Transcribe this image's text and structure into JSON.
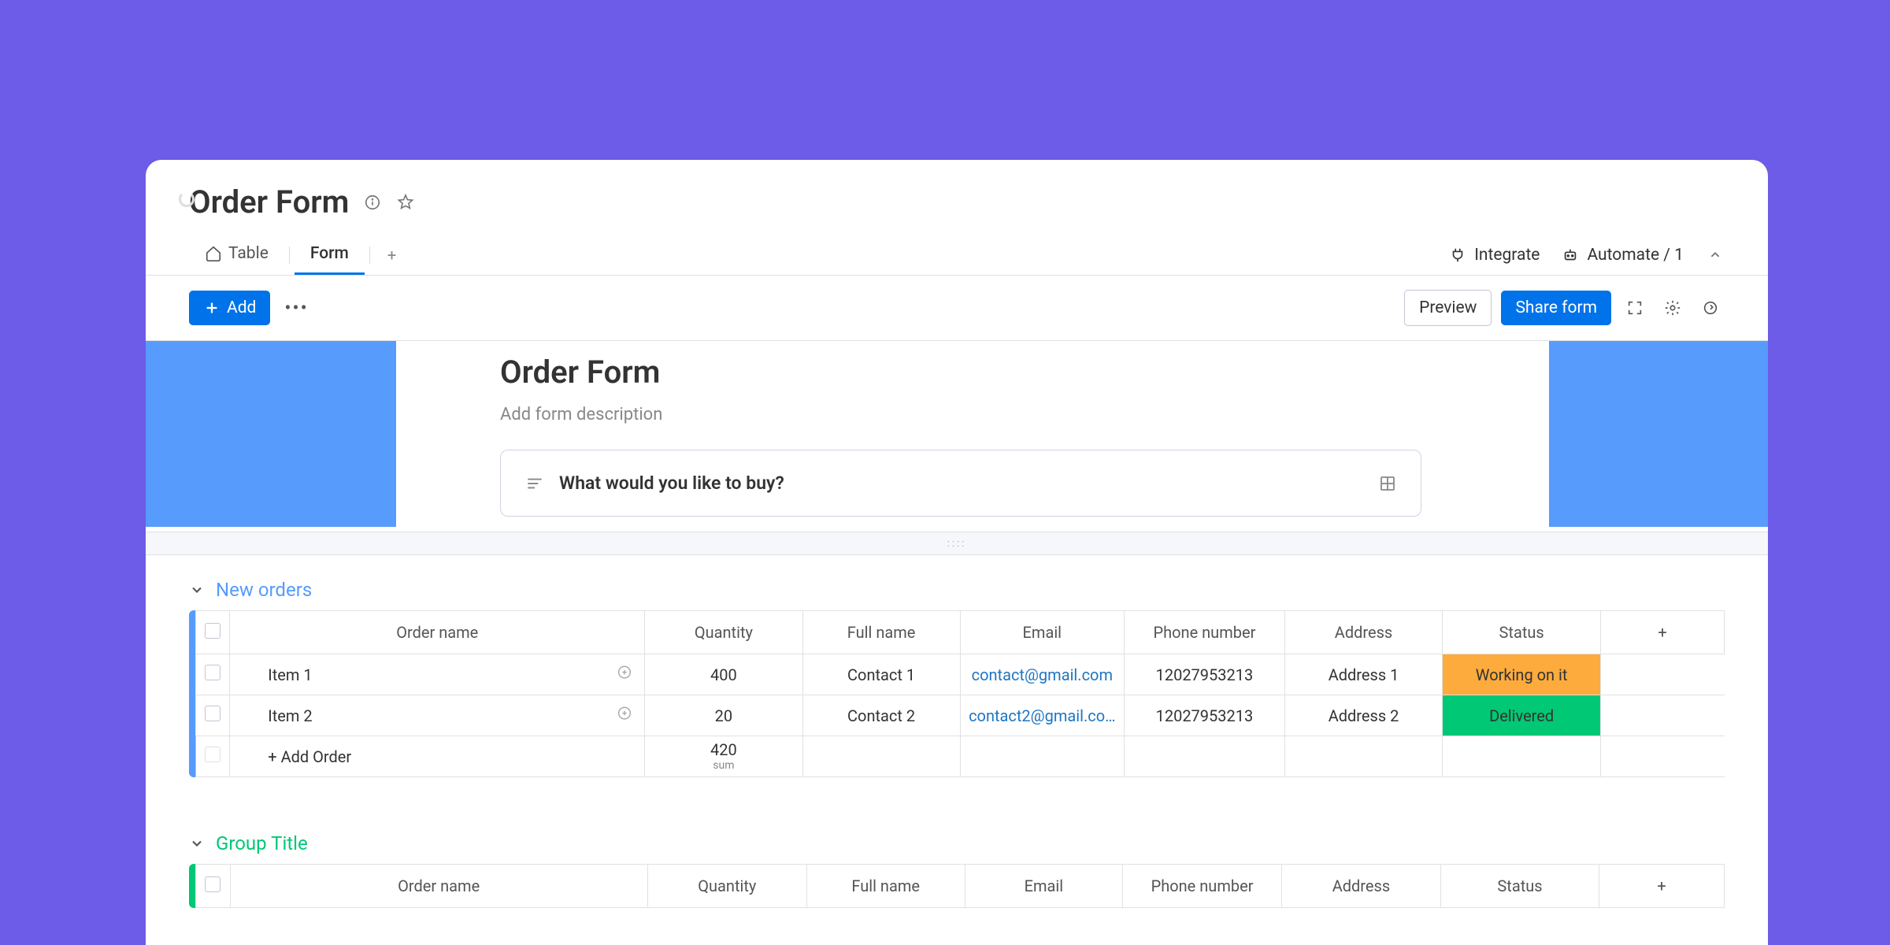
{
  "header": {
    "title": "Order Form"
  },
  "tabs": {
    "table": "Table",
    "form": "Form",
    "integrate": "Integrate",
    "automate": "Automate / 1"
  },
  "toolbar": {
    "add": "Add",
    "preview": "Preview",
    "share": "Share form"
  },
  "form": {
    "title": "Order Form",
    "description": "Add form description",
    "question": "What would you like to buy?"
  },
  "columns": {
    "order_name": "Order name",
    "quantity": "Quantity",
    "full_name": "Full name",
    "email": "Email",
    "phone": "Phone number",
    "address": "Address",
    "status": "Status"
  },
  "groups": [
    {
      "title": "New orders",
      "color": "blue",
      "rows": [
        {
          "name": "Item 1",
          "quantity": "400",
          "full_name": "Contact 1",
          "email": "contact@gmail.com",
          "phone": "12027953213",
          "address": "Address 1",
          "status": "Working on it",
          "status_class": "status-working"
        },
        {
          "name": "Item 2",
          "quantity": "20",
          "full_name": "Contact 2",
          "email": "contact2@gmail.co…",
          "phone": "12027953213",
          "address": "Address 2",
          "status": "Delivered",
          "status_class": "status-delivered"
        }
      ],
      "add_label": "+ Add Order",
      "sum": {
        "value": "420",
        "label": "sum"
      }
    },
    {
      "title": "Group Title",
      "color": "green"
    }
  ]
}
